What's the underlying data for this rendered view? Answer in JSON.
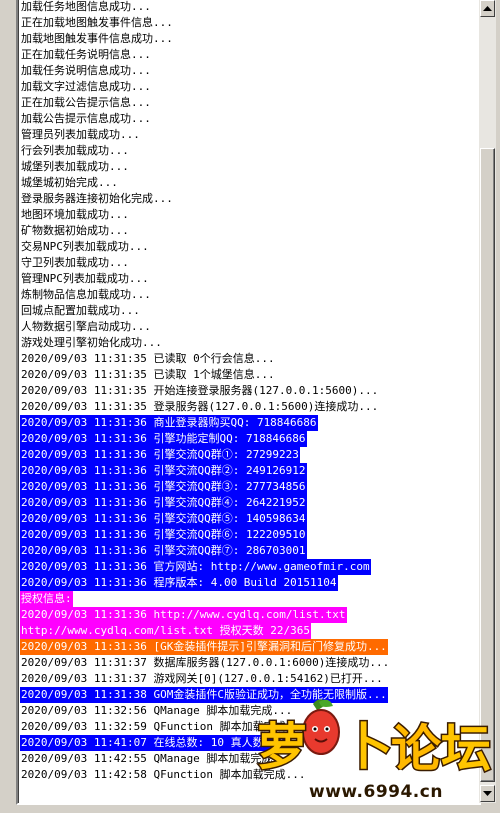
{
  "log": {
    "lines": [
      {
        "text": "加载任务地图信息成功...",
        "style": "plain"
      },
      {
        "text": "正在加载地图触发事件信息...",
        "style": "plain"
      },
      {
        "text": "加载地图触发事件信息成功...",
        "style": "plain"
      },
      {
        "text": "正在加载任务说明信息...",
        "style": "plain"
      },
      {
        "text": "加载任务说明信息成功...",
        "style": "plain"
      },
      {
        "text": "加载文字过滤信息成功...",
        "style": "plain"
      },
      {
        "text": "正在加载公告提示信息...",
        "style": "plain"
      },
      {
        "text": "加载公告提示信息成功...",
        "style": "plain"
      },
      {
        "text": "管理员列表加载成功...",
        "style": "plain"
      },
      {
        "text": "行会列表加载成功...",
        "style": "plain"
      },
      {
        "text": "城堡列表加载成功...",
        "style": "plain"
      },
      {
        "text": "城堡城初始完成...",
        "style": "plain"
      },
      {
        "text": "登录服务器连接初始化完成...",
        "style": "plain"
      },
      {
        "text": "地图环境加载成功...",
        "style": "plain"
      },
      {
        "text": "矿物数据初始成功...",
        "style": "plain"
      },
      {
        "text": "交易NPC列表加载成功...",
        "style": "plain"
      },
      {
        "text": "守卫列表加载成功...",
        "style": "plain"
      },
      {
        "text": "管理NPC列表加载成功...",
        "style": "plain"
      },
      {
        "text": "炼制物品信息加载成功...",
        "style": "plain"
      },
      {
        "text": "回城点配置加载成功...",
        "style": "plain"
      },
      {
        "text": "人物数据引擎启动成功...",
        "style": "plain"
      },
      {
        "text": "游戏处理引擎初始化成功...",
        "style": "plain"
      },
      {
        "text": "2020/09/03 11:31:35 已读取 0个行会信息...",
        "style": "plain"
      },
      {
        "text": "2020/09/03 11:31:35 已读取 1个城堡信息...",
        "style": "plain"
      },
      {
        "text": "2020/09/03 11:31:35 开始连接登录服务器(127.0.0.1:5600)...",
        "style": "plain"
      },
      {
        "text": "2020/09/03 11:31:35 登录服务器(127.0.0.1:5600)连接成功...",
        "style": "plain"
      },
      {
        "text": "2020/09/03 11:31:36 商业登录器购买QQ: 718846686",
        "style": "blue"
      },
      {
        "text": "2020/09/03 11:31:36 引擎功能定制QQ: 718846686",
        "style": "blue"
      },
      {
        "text": "2020/09/03 11:31:36 引擎交流QQ群①: 27299223",
        "style": "blue"
      },
      {
        "text": "2020/09/03 11:31:36 引擎交流QQ群②: 249126912",
        "style": "blue"
      },
      {
        "text": "2020/09/03 11:31:36 引擎交流QQ群③: 277734856",
        "style": "blue"
      },
      {
        "text": "2020/09/03 11:31:36 引擎交流QQ群④: 264221952",
        "style": "blue"
      },
      {
        "text": "2020/09/03 11:31:36 引擎交流QQ群⑤: 140598634",
        "style": "blue"
      },
      {
        "text": "2020/09/03 11:31:36 引擎交流QQ群⑥: 122209510",
        "style": "blue"
      },
      {
        "text": "2020/09/03 11:31:36 引擎交流QQ群⑦: 286703001",
        "style": "blue"
      },
      {
        "text": "2020/09/03 11:31:36 官方网站: http://www.gameofmir.com",
        "style": "blue"
      },
      {
        "text": "2020/09/03 11:31:36 程序版本: 4.00 Build 20151104",
        "style": "blue"
      },
      {
        "text": "授权信息:",
        "style": "magenta"
      },
      {
        "text": "2020/09/03 11:31:36 http://www.cydlq.com/list.txt",
        "style": "magenta"
      },
      {
        "text": "http://www.cydlq.com/list.txt 授权天数 22/365",
        "style": "magenta"
      },
      {
        "text": "2020/09/03 11:31:36 [GK金装插件提示]引擎漏洞和后门修复成功...",
        "style": "orange"
      },
      {
        "text": "2020/09/03 11:31:37 数据库服务器(127.0.0.1:6000)连接成功...",
        "style": "plain"
      },
      {
        "text": "2020/09/03 11:31:37 游戏网关[0](127.0.0.1:54162)已打开...",
        "style": "plain"
      },
      {
        "text": "2020/09/03 11:31:38 GOM金装插件C版验证成功，全功能无限制版...",
        "style": "blue"
      },
      {
        "text": "2020/09/03 11:32:56 QManage 脚本加载完成...",
        "style": "plain"
      },
      {
        "text": "2020/09/03 11:32:59 QFunction 脚本加载完成...",
        "style": "plain"
      },
      {
        "text": "2020/09/03 11:41:07 在线总数: 10 真人数: 0",
        "style": "blue"
      },
      {
        "text": "2020/09/03 11:42:55 QManage 脚本加载完成...",
        "style": "plain"
      },
      {
        "text": "2020/09/03 11:42:58 QFunction 脚本加载完成...",
        "style": "plain"
      }
    ]
  },
  "scrollbar": {
    "up_icon": "arrow-up-icon",
    "down_icon": "arrow-down-icon"
  },
  "watermark": {
    "logo_text": "萝卜论坛",
    "url": "www.6994.cn"
  },
  "colors": {
    "blue_highlight": "#0000ff",
    "magenta_highlight": "#ff00ff",
    "orange_highlight": "#ff6a00"
  }
}
